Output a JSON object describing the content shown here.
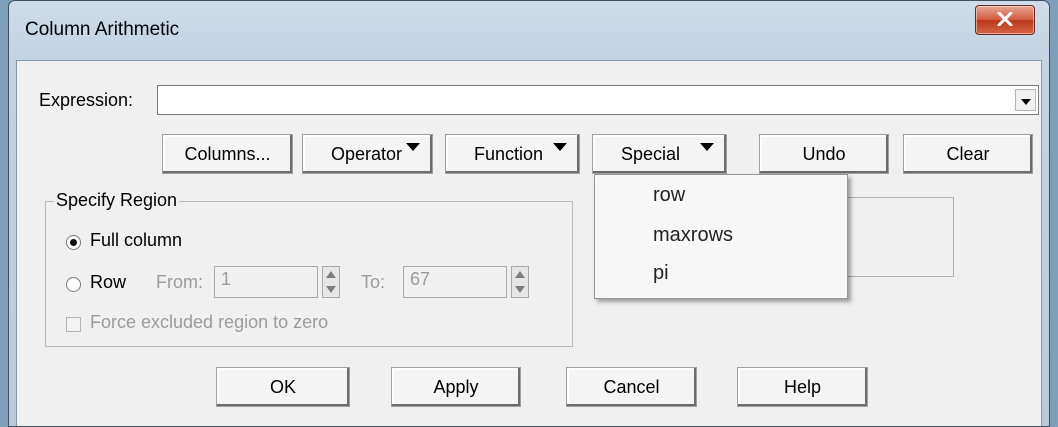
{
  "window": {
    "title": "Column Arithmetic"
  },
  "expression": {
    "label": "Expression:",
    "value": ""
  },
  "toolbar": {
    "columns_label": "Columns...",
    "operator_label": "Operator",
    "function_label": "Function",
    "special_label": "Special",
    "undo_label": "Undo",
    "clear_label": "Clear"
  },
  "region": {
    "title": "Specify Region",
    "full_column_label": "Full column",
    "row_label": "Row",
    "from_label": "From:",
    "from_value": "1",
    "to_label": "To:",
    "to_value": "67",
    "force_label": "Force excluded region to zero",
    "selected": "full_column"
  },
  "special_menu": {
    "items": [
      {
        "label": "row"
      },
      {
        "label": "maxrows"
      },
      {
        "label": "pi"
      }
    ]
  },
  "footer": {
    "ok_label": "OK",
    "apply_label": "Apply",
    "cancel_label": "Cancel",
    "help_label": "Help"
  },
  "icons": {
    "close": "close-x-icon",
    "dropdown": "chevron-down-icon",
    "spin": "spin-updown-icon"
  },
  "colors": {
    "close_button": "#c8492c",
    "title_bar": "#c4d5e5",
    "dialog_bg": "#f0f0f0"
  }
}
